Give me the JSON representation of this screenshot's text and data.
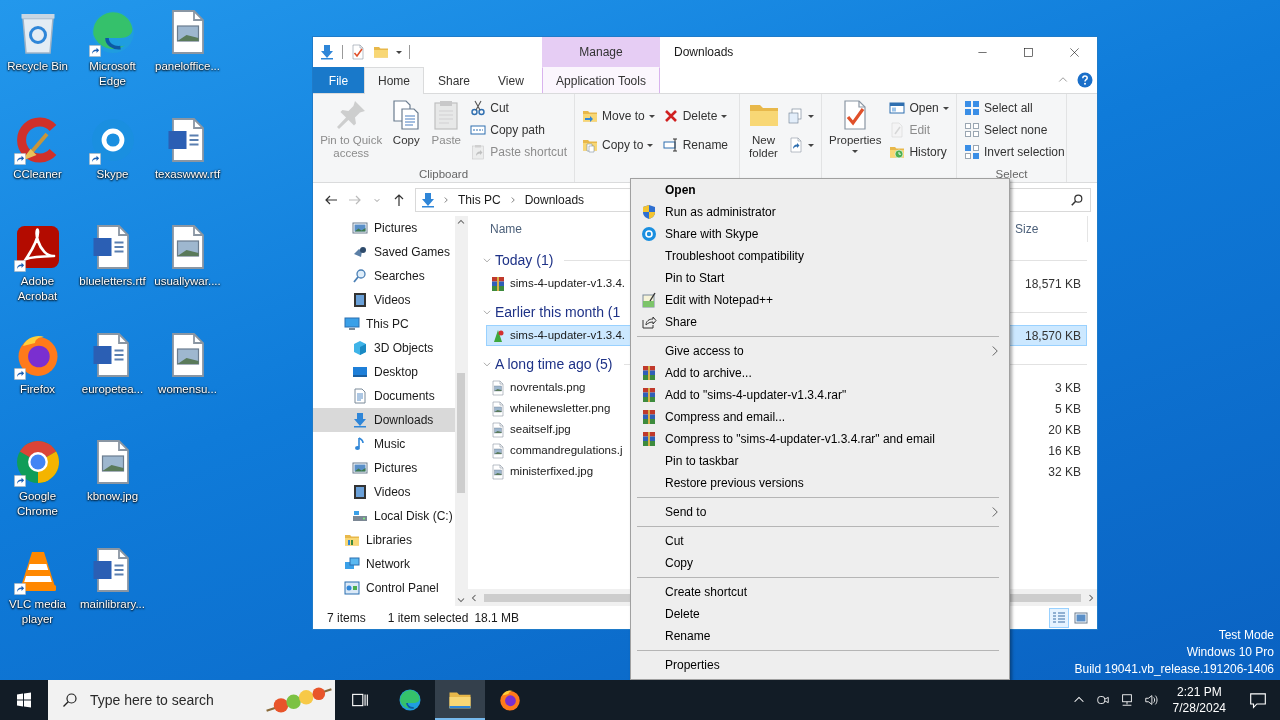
{
  "desktop_icons": [
    {
      "label": "Recycle Bin",
      "kind": "recycle",
      "shortcut": false
    },
    {
      "label": "CCleaner",
      "kind": "ccleaner",
      "shortcut": true
    },
    {
      "label": "Adobe Acrobat",
      "kind": "acrobat",
      "shortcut": true
    },
    {
      "label": "Firefox",
      "kind": "firefox",
      "shortcut": true
    },
    {
      "label": "Google Chrome",
      "kind": "chrome",
      "shortcut": true
    },
    {
      "label": "VLC media player",
      "kind": "vlc",
      "shortcut": true
    },
    {
      "label": "Microsoft Edge",
      "kind": "edge",
      "shortcut": true
    },
    {
      "label": "Skype",
      "kind": "skype",
      "shortcut": true
    },
    {
      "label": "blueletters.rtf",
      "kind": "word",
      "shortcut": false
    },
    {
      "label": "europetea...",
      "kind": "word",
      "shortcut": false
    },
    {
      "label": "kbnow.jpg",
      "kind": "image",
      "shortcut": false
    },
    {
      "label": "mainlibrary...",
      "kind": "word",
      "shortcut": false
    },
    {
      "label": "paneloffice...",
      "kind": "image",
      "shortcut": false
    },
    {
      "label": "texaswww.rtf",
      "kind": "word",
      "shortcut": false
    },
    {
      "label": "usuallywar....",
      "kind": "image",
      "shortcut": false
    },
    {
      "label": "womensu...",
      "kind": "image",
      "shortcut": false
    }
  ],
  "explorer": {
    "contextual_header": "Manage",
    "title": "Downloads",
    "tabs": [
      {
        "label": "File",
        "kind": "file",
        "selected": false
      },
      {
        "label": "Home",
        "kind": "standard",
        "selected": true
      },
      {
        "label": "Share",
        "kind": "standard",
        "selected": false
      },
      {
        "label": "View",
        "kind": "standard",
        "selected": false
      },
      {
        "label": "Application Tools",
        "kind": "contextual",
        "selected": false
      }
    ],
    "ribbon_groups": [
      {
        "label": "Clipboard",
        "columns": [
          [
            {
              "label": "Pin to Quick access",
              "kind": "large",
              "disabled": true,
              "dropdown": false
            }
          ],
          [
            {
              "label": "Copy",
              "kind": "large",
              "disabled": false,
              "dropdown": false
            }
          ],
          [
            {
              "label": "Paste",
              "kind": "large",
              "disabled": true,
              "dropdown": false
            }
          ],
          [
            {
              "label": "Cut",
              "kind": "small",
              "disabled": false,
              "dropdown": false
            },
            {
              "label": "Copy path",
              "kind": "small",
              "disabled": false,
              "dropdown": false
            },
            {
              "label": "Paste shortcut",
              "kind": "small",
              "disabled": true,
              "dropdown": false
            }
          ]
        ]
      },
      {
        "columns": [
          [
            {
              "label": "Move to",
              "kind": "small",
              "disabled": false,
              "dropdown": true
            },
            {
              "label": "Copy to",
              "kind": "small",
              "disabled": false,
              "dropdown": true
            }
          ],
          [
            {
              "label": "Delete",
              "kind": "small",
              "disabled": false,
              "dropdown": true
            },
            {
              "label": "Rename",
              "kind": "small",
              "disabled": false,
              "dropdown": false
            }
          ]
        ]
      },
      {
        "columns": [
          [
            {
              "label": "New folder",
              "kind": "large",
              "disabled": false,
              "dropdown": false
            }
          ],
          [
            {
              "kind": "small",
              "disabled": false,
              "dropdown": true
            },
            {
              "kind": "small",
              "disabled": false,
              "dropdown": true
            }
          ]
        ]
      },
      {
        "columns": [
          [
            {
              "label": "Properties",
              "kind": "large",
              "disabled": false,
              "dropdown": true
            }
          ],
          [
            {
              "label": "Open",
              "kind": "small",
              "disabled": false,
              "dropdown": true
            },
            {
              "label": "Edit",
              "kind": "small",
              "disabled": true,
              "dropdown": false
            },
            {
              "label": "History",
              "kind": "small",
              "disabled": false,
              "dropdown": false
            }
          ]
        ]
      },
      {
        "label": "Select",
        "columns": [
          [
            {
              "label": "Select all",
              "kind": "small",
              "disabled": false,
              "dropdown": false
            },
            {
              "label": "Select none",
              "kind": "small",
              "disabled": false,
              "dropdown": false
            },
            {
              "label": "Invert selection",
              "kind": "small",
              "disabled": false,
              "dropdown": false
            }
          ]
        ]
      }
    ],
    "address": [
      "This PC",
      "Downloads"
    ],
    "nav_pane": {
      "items": [
        {
          "children": [
            {
              "label": "Pictures",
              "kind": "pictures",
              "selected": false
            },
            {
              "label": "Saved Games",
              "kind": "games",
              "selected": false
            },
            {
              "label": "Searches",
              "kind": "searches",
              "selected": false
            },
            {
              "label": "Videos",
              "kind": "videos",
              "selected": false
            }
          ]
        },
        {
          "label": "This PC",
          "kind": "pc",
          "selected": false,
          "children": [
            {
              "label": "3D Objects",
              "kind": "objects3d",
              "selected": false
            },
            {
              "label": "Desktop",
              "kind": "desktop",
              "selected": false
            },
            {
              "label": "Documents",
              "kind": "documents",
              "selected": false
            },
            {
              "label": "Downloads",
              "kind": "downloads",
              "selected": true
            },
            {
              "label": "Music",
              "kind": "music",
              "selected": false
            },
            {
              "label": "Pictures",
              "kind": "pictures",
              "selected": false
            },
            {
              "label": "Videos",
              "kind": "videos",
              "selected": false
            },
            {
              "label": "Local Disk (C:)",
              "kind": "disk",
              "selected": false
            }
          ]
        },
        {
          "label": "Libraries",
          "kind": "libraries",
          "selected": false
        },
        {
          "label": "Network",
          "kind": "network",
          "selected": false
        },
        {
          "label": "Control Panel",
          "kind": "controlpanel",
          "selected": false
        }
      ]
    },
    "columns": [
      "Name",
      "Size"
    ],
    "file_groups": [
      {
        "label": "Today (1)",
        "files": [
          {
            "name": "sims-4-updater-v1.3.4.",
            "size": "18,571 KB",
            "kind": "archive",
            "selected": false
          }
        ]
      },
      {
        "label": "Earlier this month (1",
        "files": [
          {
            "name": "sims-4-updater-v1.3.4.",
            "size": "18,570 KB",
            "kind": "program",
            "selected": true
          }
        ]
      },
      {
        "label": "A long time ago (5)",
        "files": [
          {
            "name": "novrentals.png",
            "size": "3 KB",
            "kind": "image",
            "selected": false
          },
          {
            "name": "whilenewsletter.png",
            "size": "5 KB",
            "kind": "image",
            "selected": false
          },
          {
            "name": "seaitself.jpg",
            "size": "20 KB",
            "kind": "image",
            "selected": false
          },
          {
            "name": "commandregulations.j",
            "size": "16 KB",
            "kind": "image",
            "selected": false
          },
          {
            "name": "ministerfixed.jpg",
            "size": "32 KB",
            "kind": "image",
            "selected": false
          }
        ]
      }
    ],
    "status": {
      "item_count": "7 items",
      "selection": "1 item selected",
      "selection_size": "18.1 MB"
    },
    "view_modes": [
      {
        "kind": "details",
        "selected": true
      },
      {
        "kind": "large_icons",
        "selected": false
      }
    ]
  },
  "context_menu": {
    "sections": [
      [
        {
          "label": "Open",
          "kind": "plain",
          "default": true,
          "submenu": false
        },
        {
          "label": "Run as administrator",
          "kind": "admin",
          "default": false,
          "submenu": false
        },
        {
          "label": "Share with Skype",
          "kind": "skype",
          "default": false,
          "submenu": false
        },
        {
          "label": "Troubleshoot compatibility",
          "kind": "plain",
          "default": false,
          "submenu": false
        },
        {
          "label": "Pin to Start",
          "kind": "plain",
          "default": false,
          "submenu": false
        },
        {
          "label": "Edit with Notepad++",
          "kind": "notepad",
          "default": false,
          "submenu": false
        },
        {
          "label": "Share",
          "kind": "share",
          "default": false,
          "submenu": false
        }
      ],
      [
        {
          "label": "Give access to",
          "kind": "plain",
          "default": false,
          "submenu": true
        },
        {
          "label": "Add to archive...",
          "kind": "archive",
          "default": false,
          "submenu": false
        },
        {
          "label": "Add to \"sims-4-updater-v1.3.4.rar\"",
          "kind": "archive",
          "default": false,
          "submenu": false
        },
        {
          "label": "Compress and email...",
          "kind": "archive",
          "default": false,
          "submenu": false
        },
        {
          "label": "Compress to \"sims-4-updater-v1.3.4.rar\" and email",
          "kind": "archive",
          "default": false,
          "submenu": false
        },
        {
          "label": "Pin to taskbar",
          "kind": "plain",
          "default": false,
          "submenu": false
        },
        {
          "label": "Restore previous versions",
          "kind": "plain",
          "default": false,
          "submenu": false
        }
      ],
      [
        {
          "label": "Send to",
          "kind": "plain",
          "default": false,
          "submenu": true
        }
      ],
      [
        {
          "label": "Cut",
          "kind": "plain",
          "default": false,
          "submenu": false
        },
        {
          "label": "Copy",
          "kind": "plain",
          "default": false,
          "submenu": false
        }
      ],
      [
        {
          "label": "Create shortcut",
          "kind": "plain",
          "default": false,
          "submenu": false
        },
        {
          "label": "Delete",
          "kind": "plain",
          "default": false,
          "submenu": false
        },
        {
          "label": "Rename",
          "kind": "plain",
          "default": false,
          "submenu": false
        }
      ],
      [
        {
          "label": "Properties",
          "kind": "plain",
          "default": false,
          "submenu": false
        }
      ]
    ]
  },
  "desktop_info": [
    "Test Mode",
    "Windows 10 Pro",
    "Build 19041.vb_release.191206-1406"
  ],
  "taskbar": {
    "search": {
      "placeholder": "Type here to search"
    },
    "apps": [
      {
        "kind": "taskview",
        "active": false
      },
      {
        "kind": "edge",
        "active": false
      },
      {
        "kind": "explorer",
        "active": true
      },
      {
        "kind": "firefox",
        "active": false
      }
    ],
    "time": "2:21 PM",
    "date": "7/28/2024"
  }
}
